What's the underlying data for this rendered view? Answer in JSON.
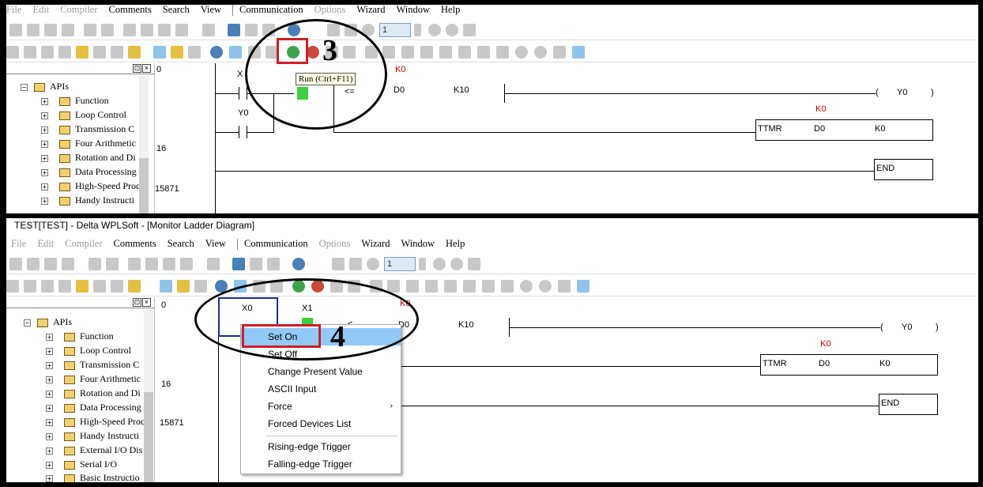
{
  "panel1": {
    "menu": {
      "file": "File",
      "edit": "Edit",
      "compiler": "Compiler",
      "comments": "Comments",
      "search": "Search",
      "view": "View",
      "communication": "Communication",
      "options": "Options",
      "wizard": "Wizard",
      "window": "Window",
      "help": "Help"
    },
    "toolbar": {
      "number_value": "1"
    },
    "tooltip": "Run (Ctrl+F11)",
    "annotation_number": "3",
    "tree": {
      "root": "APIs",
      "items": [
        "Function",
        "Loop Control",
        "Transmission C",
        "Four Arithmetic",
        "Rotation and Di",
        "Data Processing",
        "High-Speed Proc",
        "Handy Instructi"
      ]
    },
    "gutter": [
      "0",
      "16",
      "15871"
    ],
    "ladder": {
      "contact1": "X",
      "contact2": "Y0",
      "k0_top": "K0",
      "cmp_op": "<=",
      "d0": "D0",
      "k10": "K10",
      "coil_open": "(",
      "coil": "Y0",
      "coil_close": ")",
      "k0_mid": "K0",
      "ttmr": "TTMR",
      "ttmr_d0": "D0",
      "ttmr_k0": "K0",
      "end": "END"
    }
  },
  "panel2": {
    "title": "TEST[TEST] - Delta WPLSoft - [Monitor Ladder Diagram]",
    "menu": {
      "file": "File",
      "edit": "Edit",
      "compiler": "Compiler",
      "comments": "Comments",
      "search": "Search",
      "view": "View",
      "communication": "Communication",
      "options": "Options",
      "wizard": "Wizard",
      "window": "Window",
      "help": "Help"
    },
    "toolbar": {
      "number_value": "1"
    },
    "annotation_number": "4",
    "tree": {
      "root": "APIs",
      "items": [
        "Function",
        "Loop Control",
        "Transmission C",
        "Four Arithmetic",
        "Rotation and Di",
        "Data Processing",
        "High-Speed Proc",
        "Handy Instructi",
        "External I/O Dis",
        "Serial I/O",
        "Basic Instructio"
      ]
    },
    "gutter": [
      "0",
      "16",
      "15871"
    ],
    "ladder": {
      "contact1": "X0",
      "contact2": "X1",
      "k0_top": "K0",
      "cmp_op": "<",
      "d0": "D0",
      "k10": "K10",
      "coil_open": "(",
      "coil": "Y0",
      "coil_close": ")",
      "k0_mid": "K0",
      "ttmr": "TTMR",
      "ttmr_d0": "D0",
      "ttmr_k0": "K0",
      "end": "END"
    },
    "context_menu": {
      "items": [
        "Set On",
        "Set Off",
        "Change Present Value",
        "ASCII Input",
        "Force",
        "Forced Devices List"
      ],
      "submenu_arrow": "›",
      "triggers": [
        "Rising-edge Trigger",
        "Falling-edge Trigger"
      ]
    }
  },
  "colors": {
    "annotation_red": "#d01e24",
    "selection": "#91c9f7",
    "contact_on": "#3ecf3e",
    "k_value_red": "#c00000"
  }
}
